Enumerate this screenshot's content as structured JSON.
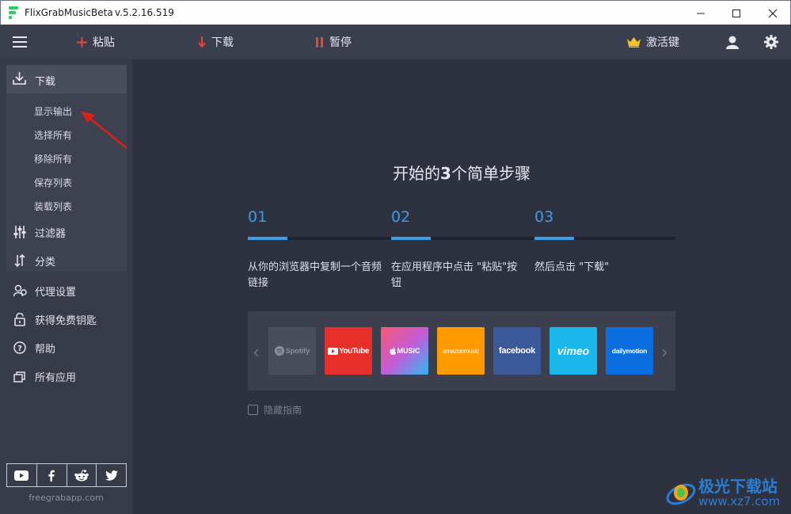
{
  "window": {
    "title": "FlixGrabMusicBeta",
    "version": "v.5.2.16.519"
  },
  "toolbar": {
    "paste_label": "粘贴",
    "download_label": "下载",
    "pause_label": "暂停",
    "activate_label": "激活键"
  },
  "sidebar": {
    "download_group": {
      "label": "下载",
      "subitems": [
        "显示输出",
        "选择所有",
        "移除所有",
        "保存列表",
        "装载列表"
      ]
    },
    "items": [
      {
        "label": "过滤器",
        "icon": "sliders-icon"
      },
      {
        "label": "分类",
        "icon": "sort-icon"
      },
      {
        "label": "代理设置",
        "icon": "proxy-icon"
      },
      {
        "label": "获得免费钥匙",
        "icon": "unlock-icon"
      },
      {
        "label": "帮助",
        "icon": "help-icon"
      },
      {
        "label": "所有应用",
        "icon": "apps-icon"
      }
    ],
    "social": [
      "youtube-icon",
      "facebook-icon",
      "reddit-icon",
      "twitter-icon"
    ],
    "site_url": "freegrabapp.com"
  },
  "main": {
    "title_prefix": "开始的",
    "title_number": "3",
    "title_suffix": "个简单步骤",
    "steps": [
      {
        "number": "01",
        "text": "从你的浏览器中复制一个音频链接"
      },
      {
        "number": "02",
        "text": "在应用程序中点击 \"粘贴\"按钮"
      },
      {
        "number": "03",
        "text": "然后点击 \"下载\""
      }
    ],
    "services": [
      {
        "name": "Spotify",
        "color": "#4a4e5a"
      },
      {
        "name": "YouTube",
        "color": "#e62e2a"
      },
      {
        "name": "MUSIC",
        "color": "#e84c7a"
      },
      {
        "name": "amazonmusic",
        "color": "#ff9a00"
      },
      {
        "name": "facebook",
        "color": "#3b5998"
      },
      {
        "name": "vimeo",
        "color": "#1ab7ea"
      },
      {
        "name": "dailymotion",
        "color": "#0b6ee0"
      }
    ],
    "hide_guide_label": "隐藏指南"
  },
  "watermark": {
    "line1": "极光下载站",
    "line2": "www.xz7.com"
  },
  "colors": {
    "accent": "#3b9ce6",
    "paste_red": "#e8453c",
    "crown_gold": "#f2c230"
  }
}
